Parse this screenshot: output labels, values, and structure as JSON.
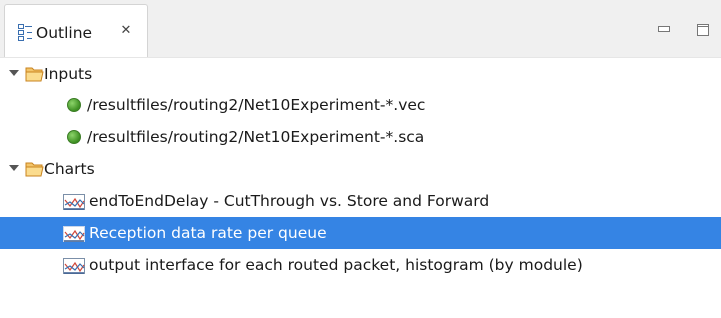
{
  "tab": {
    "title": "Outline",
    "close_glyph": "✕"
  },
  "icons": {
    "tab_icon": "outline-icon",
    "folder": "open-folder-icon",
    "input_file": "green-dot-icon",
    "chart": "line-chart-icon"
  },
  "colors": {
    "selection": "#3584e4",
    "folder": "#e8a33a",
    "input_dot": "#4ea02d"
  },
  "tree": {
    "inputs": {
      "label": "Inputs",
      "items": [
        {
          "label": "/resultfiles/routing2/Net10Experiment-*.vec"
        },
        {
          "label": "/resultfiles/routing2/Net10Experiment-*.sca"
        }
      ]
    },
    "charts": {
      "label": "Charts",
      "items": [
        {
          "label": "endToEndDelay - CutThrough vs. Store and Forward",
          "selected": false
        },
        {
          "label": "Reception data rate per queue",
          "selected": true
        },
        {
          "label": "output interface for each routed packet, histogram (by module)",
          "selected": false
        }
      ]
    }
  }
}
